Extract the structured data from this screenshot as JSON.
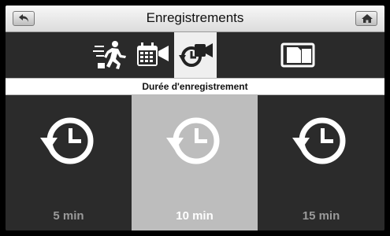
{
  "header": {
    "title": "Enregistrements",
    "back_icon": "back-arrow-icon",
    "home_icon": "home-icon"
  },
  "tabs": [
    {
      "icon": "motion-detection-icon",
      "active": false
    },
    {
      "icon": "scheduled-recording-icon",
      "active": false
    },
    {
      "icon": "recording-duration-icon",
      "active": true
    },
    {
      "icon": "sd-card-icon",
      "active": false
    }
  ],
  "section": {
    "title": "Durée d'enregistrement"
  },
  "options": [
    {
      "label": "5 min",
      "icon": "clock-history-icon",
      "selected": false
    },
    {
      "label": "10 min",
      "icon": "clock-history-icon",
      "selected": true
    },
    {
      "label": "15 min",
      "icon": "clock-history-icon",
      "selected": false
    }
  ],
  "colors": {
    "panel_dark": "#2b2b2b",
    "selected": "#bdbdbd",
    "active_tab": "#efefef",
    "label_dim": "#9a9a9a"
  }
}
